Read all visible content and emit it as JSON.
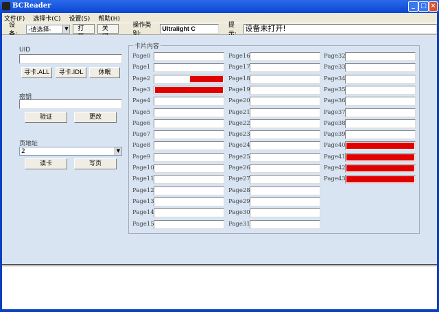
{
  "window": {
    "title": "BCReader"
  },
  "menu": [
    "文件(F)",
    "选择卡(C)",
    "设置(S)",
    "帮助(H)"
  ],
  "toolbar": {
    "device_label": "设 备:",
    "device_value": "-请选择-",
    "open": "打开",
    "close": "关闭",
    "op_type_label": "操作类别:",
    "op_type_value": "Ultralight C",
    "hint_label": "提示:",
    "hint_value": "设备未打开!"
  },
  "left": {
    "uid_label": "UID",
    "uid_value": "",
    "find_all": "寻卡.ALL",
    "find_idl": "寻卡.IDL",
    "sleep": "休眠",
    "key_label": "密钥",
    "key_value": "",
    "verify": "验证",
    "change": "更改",
    "page_addr_label": "页地址",
    "page_addr_value": "2",
    "read": "读卡",
    "write": "写页"
  },
  "card": {
    "caption": "卡片内容",
    "pages": [
      {
        "label": "Page0",
        "fill": 0
      },
      {
        "label": "Page1",
        "fill": 0
      },
      {
        "label": "Page2",
        "fill": 0.5
      },
      {
        "label": "Page3",
        "fill": 1
      },
      {
        "label": "Page4",
        "fill": 0
      },
      {
        "label": "Page5",
        "fill": 0
      },
      {
        "label": "Page6",
        "fill": 0
      },
      {
        "label": "Page7",
        "fill": 0
      },
      {
        "label": "Page8",
        "fill": 0
      },
      {
        "label": "Page9",
        "fill": 0
      },
      {
        "label": "Page10",
        "fill": 0
      },
      {
        "label": "Page11",
        "fill": 0
      },
      {
        "label": "Page12",
        "fill": 0
      },
      {
        "label": "Page13",
        "fill": 0
      },
      {
        "label": "Page14",
        "fill": 0
      },
      {
        "label": "Page15",
        "fill": 0
      },
      {
        "label": "Page16",
        "fill": 0
      },
      {
        "label": "Page17",
        "fill": 0
      },
      {
        "label": "Page18",
        "fill": 0
      },
      {
        "label": "Page19",
        "fill": 0
      },
      {
        "label": "Page20",
        "fill": 0
      },
      {
        "label": "Page21",
        "fill": 0
      },
      {
        "label": "Page22",
        "fill": 0
      },
      {
        "label": "Page23",
        "fill": 0
      },
      {
        "label": "Page24",
        "fill": 0
      },
      {
        "label": "Page25",
        "fill": 0
      },
      {
        "label": "Page26",
        "fill": 0
      },
      {
        "label": "Page27",
        "fill": 0
      },
      {
        "label": "Page28",
        "fill": 0
      },
      {
        "label": "Page29",
        "fill": 0
      },
      {
        "label": "Page30",
        "fill": 0
      },
      {
        "label": "Page31",
        "fill": 0
      },
      {
        "label": "Page32",
        "fill": 0
      },
      {
        "label": "Page33",
        "fill": 0
      },
      {
        "label": "Page34",
        "fill": 0
      },
      {
        "label": "Page35",
        "fill": 0
      },
      {
        "label": "Page36",
        "fill": 0
      },
      {
        "label": "Page37",
        "fill": 0
      },
      {
        "label": "Page38",
        "fill": 0
      },
      {
        "label": "Page39",
        "fill": 0
      },
      {
        "label": "Page40",
        "fill": 1
      },
      {
        "label": "Page41",
        "fill": 1
      },
      {
        "label": "Page42",
        "fill": 1
      },
      {
        "label": "Page43",
        "fill": 1
      }
    ]
  },
  "colors": {
    "filled": "#e00000"
  }
}
